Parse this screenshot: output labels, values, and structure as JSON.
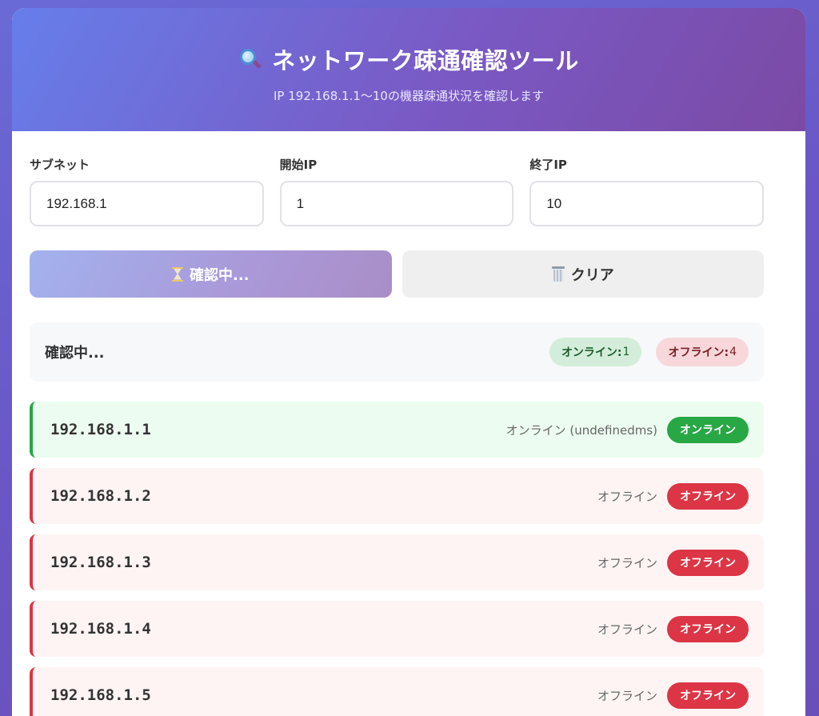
{
  "header": {
    "icon": "magnifying-glass-icon",
    "title": "ネットワーク疎通確認ツール",
    "subtitle": "IP 192.168.1.1〜10の機器疎通状況を確認します"
  },
  "form": {
    "subnet": {
      "label": "サブネット",
      "value": "192.168.1"
    },
    "start_ip": {
      "label": "開始IP",
      "value": "1"
    },
    "end_ip": {
      "label": "終了IP",
      "value": "10"
    }
  },
  "buttons": {
    "check": {
      "icon": "hourglass-icon",
      "label": "確認中..."
    },
    "clear": {
      "icon": "trash-icon",
      "label": "クリア"
    }
  },
  "status": {
    "text": "確認中...",
    "online_label": "オンライン:",
    "online_count": "1",
    "offline_label": "オフライン:",
    "offline_count": "4"
  },
  "results": [
    {
      "ip": "192.168.1.1",
      "state": "online",
      "detail": "オンライン (undefinedms)",
      "badge": "オンライン"
    },
    {
      "ip": "192.168.1.2",
      "state": "offline",
      "detail": "オフライン",
      "badge": "オフライン"
    },
    {
      "ip": "192.168.1.3",
      "state": "offline",
      "detail": "オフライン",
      "badge": "オフライン"
    },
    {
      "ip": "192.168.1.4",
      "state": "offline",
      "detail": "オフライン",
      "badge": "オフライン"
    },
    {
      "ip": "192.168.1.5",
      "state": "offline",
      "detail": "オフライン",
      "badge": "オフライン"
    }
  ],
  "colors": {
    "online": "#28a745",
    "offline": "#dc3545",
    "accent": "#667eea"
  }
}
